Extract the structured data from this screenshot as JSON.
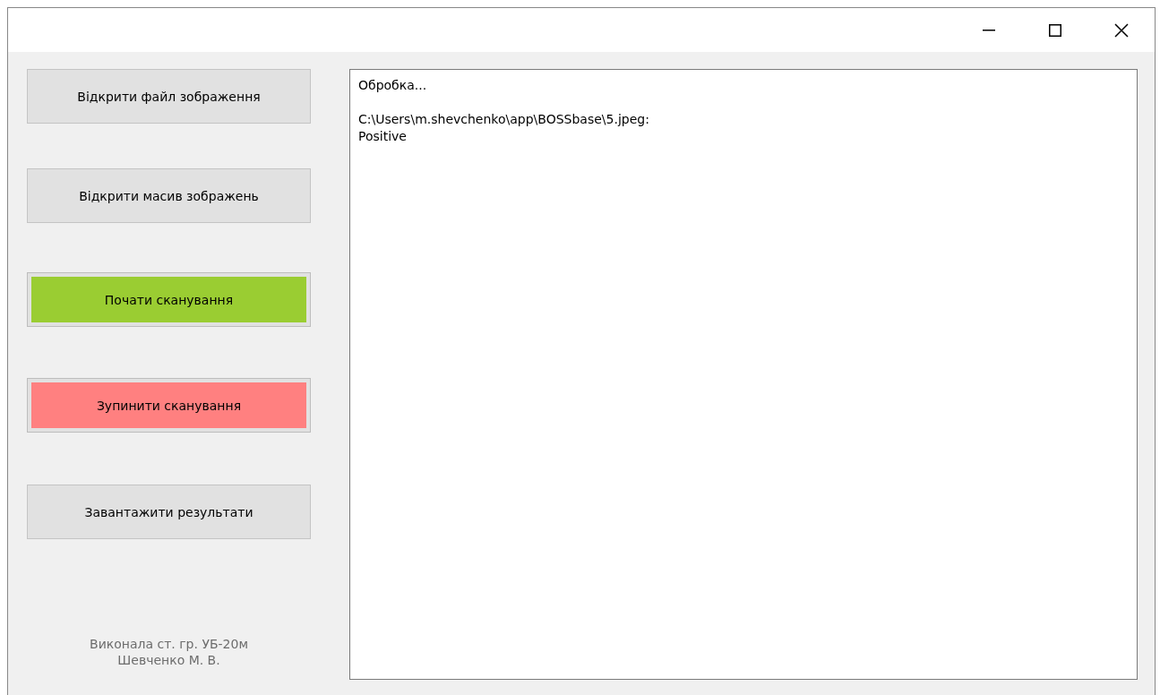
{
  "buttons": [
    {
      "label": "Відкрити файл зображення",
      "kind": "default"
    },
    {
      "label": "Відкрити масив зображень",
      "kind": "default"
    },
    {
      "label": "Почати сканування",
      "kind": "start"
    },
    {
      "label": "Зупинити сканування",
      "kind": "stop"
    },
    {
      "label": "Завантажити результати",
      "kind": "default"
    }
  ],
  "footer": [
    "Виконала ст. гр. УБ-20м",
    "Шевченко М. В."
  ],
  "output": {
    "paragraphs": [
      [
        "Обробка..."
      ],
      [
        "C:\\Users\\m.shevchenko\\app\\BOSSbase\\5.jpeg:",
        "Positive"
      ]
    ]
  }
}
